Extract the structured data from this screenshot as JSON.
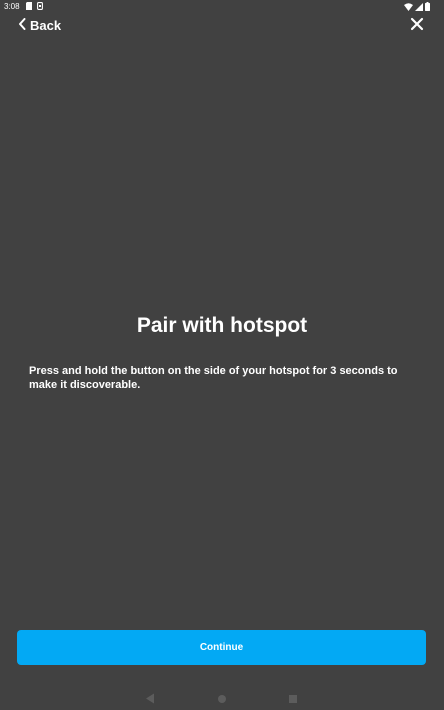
{
  "status_bar": {
    "time": "3:08",
    "left_icons": [
      "sd-card-icon",
      "sim-icon"
    ],
    "right_icons": [
      "wifi-icon",
      "signal-icon",
      "battery-icon"
    ]
  },
  "header": {
    "back_label": "Back",
    "back_icon": "chevron-left-icon",
    "close_icon": "close-icon"
  },
  "main": {
    "title": "Pair with hotspot",
    "instructions": "Press and hold the button on the side of your hotspot for 3 seconds to make it discoverable."
  },
  "footer": {
    "continue_label": "Continue"
  },
  "nav_bar": {
    "buttons": [
      "nav-back-icon",
      "nav-home-icon",
      "nav-recents-icon"
    ]
  },
  "colors": {
    "background": "#414141",
    "accent": "#03a9f4",
    "text": "#ffffff"
  }
}
